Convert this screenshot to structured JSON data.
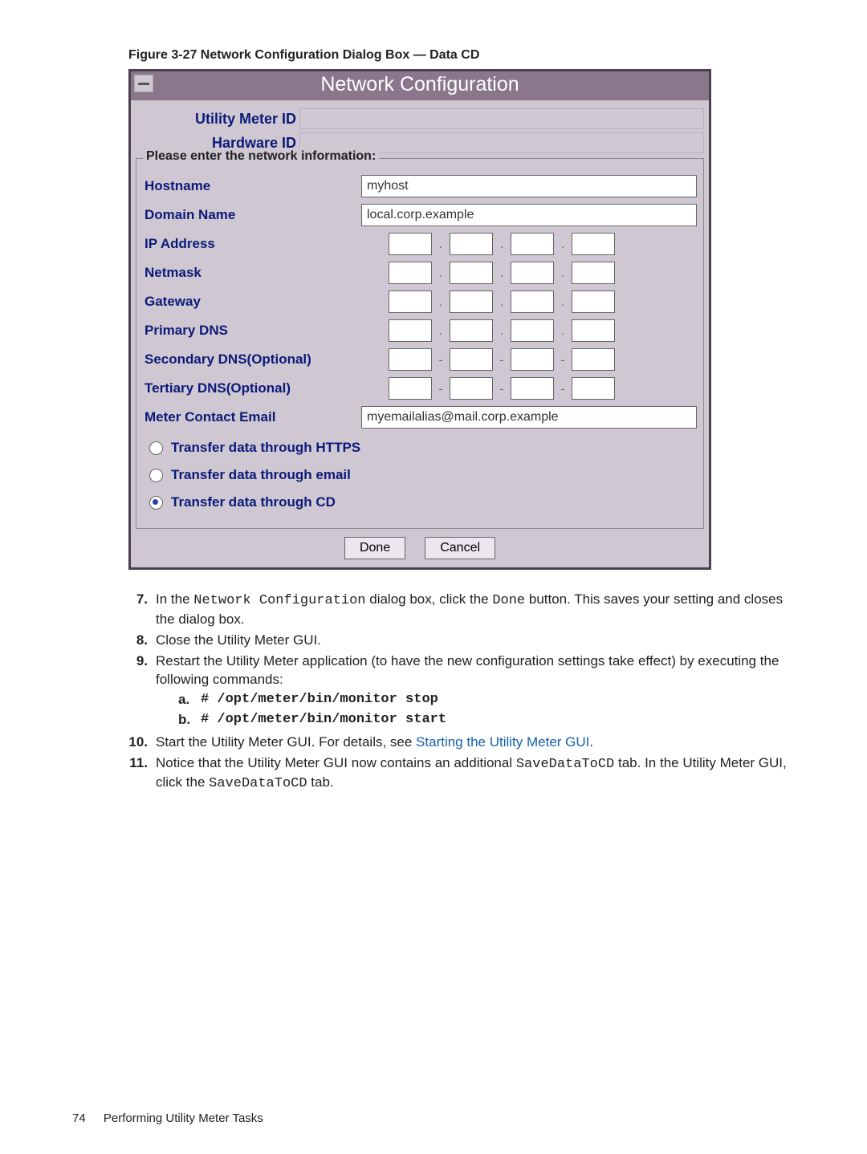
{
  "figure_caption": "Figure 3-27 Network Configuration Dialog Box — Data CD",
  "dialog": {
    "title": "Network Configuration",
    "utility_meter_id_label": "Utility Meter ID",
    "utility_meter_id_value": "",
    "hardware_id_label": "Hardware ID",
    "hardware_id_value": "",
    "fieldset_legend": "Please enter the network information:",
    "labels": {
      "hostname": "Hostname",
      "domain": "Domain Name",
      "ip": "IP Address",
      "netmask": "Netmask",
      "gateway": "Gateway",
      "pdns": "Primary DNS",
      "sdns": "Secondary DNS(Optional)",
      "tdns": "Tertiary DNS(Optional)",
      "email": "Meter Contact Email"
    },
    "values": {
      "hostname": "myhost",
      "domain": "local.corp.example",
      "email": "myemailalias@mail.corp.example"
    },
    "ip_dot": ".",
    "ip_dash": "-",
    "radio": {
      "https": "Transfer data through HTTPS",
      "email": "Transfer data through email",
      "cd": "Transfer data through CD"
    },
    "buttons": {
      "done": "Done",
      "cancel": "Cancel"
    }
  },
  "steps": {
    "s7a": "In the ",
    "s7code1": "Network Configuration",
    "s7b": " dialog box, click the ",
    "s7code2": "Done",
    "s7c": " button. This saves your setting and closes the dialog box.",
    "s8": "Close the Utility Meter GUI.",
    "s9": "Restart the Utility Meter application (to have the new configuration settings take effect) by executing the following commands:",
    "s9a": "# /opt/meter/bin/monitor stop",
    "s9b": "# /opt/meter/bin/monitor start",
    "s10a": "Start the Utility Meter GUI. For details, see ",
    "s10link": "Starting the Utility Meter GUI",
    "s10b": ".",
    "s11a": "Notice that the Utility Meter GUI now contains an additional ",
    "s11code1": "SaveDataToCD",
    "s11b": " tab. In the Utility Meter GUI, click the ",
    "s11code2": "SaveDataToCD",
    "s11c": " tab.",
    "n7": "7.",
    "n8": "8.",
    "n9": "9.",
    "n10": "10.",
    "n11": "11.",
    "na": "a.",
    "nb": "b."
  },
  "footer": {
    "page": "74",
    "title": "Performing Utility Meter Tasks"
  }
}
